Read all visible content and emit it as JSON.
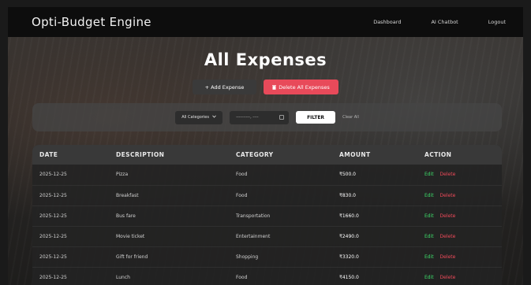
{
  "navbar": {
    "brand": "Opti-Budget Engine",
    "links": [
      "Dashboard",
      "AI Chatbot",
      "Logout"
    ]
  },
  "page": {
    "title": "All Expenses",
    "add_button": "+ Add Expense",
    "delete_all_button": "Delete All Expenses",
    "delete_icon": "trash-icon"
  },
  "filters": {
    "category_select": "All Categories",
    "date_placeholder": "----------, ----",
    "filter_button": "FILTER",
    "clear_link": "Clear All"
  },
  "table": {
    "headers": [
      "DATE",
      "DESCRIPTION",
      "CATEGORY",
      "AMOUNT",
      "ACTION"
    ],
    "rows": [
      {
        "date": "2025-12-25",
        "description": "Pizza",
        "category": "Food",
        "amount": "₹500.0"
      },
      {
        "date": "2025-12-25",
        "description": "Breakfast",
        "category": "Food",
        "amount": "₹830.0"
      },
      {
        "date": "2025-12-25",
        "description": "Bus fare",
        "category": "Transportation",
        "amount": "₹1660.0"
      },
      {
        "date": "2025-12-25",
        "description": "Movie ticket",
        "category": "Entertainment",
        "amount": "₹2490.0"
      },
      {
        "date": "2025-12-25",
        "description": "Gift for friend",
        "category": "Shopping",
        "amount": "₹3320.0"
      },
      {
        "date": "2025-12-25",
        "description": "Lunch",
        "category": "Food",
        "amount": "₹4150.0"
      }
    ],
    "edit_label": "Edit",
    "delete_label": "Delete"
  },
  "colors": {
    "accent_red": "#e84a5a",
    "edit_green": "#3ddc6a",
    "navbar_bg": "#0d0d0d"
  }
}
